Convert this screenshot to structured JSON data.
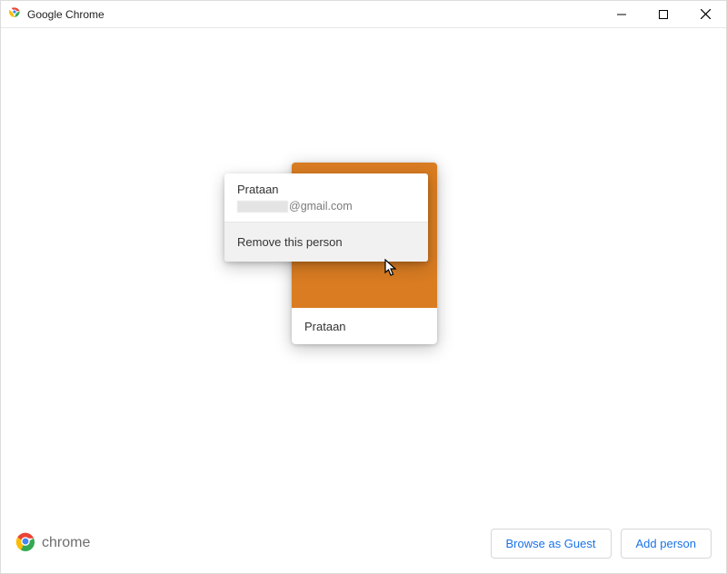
{
  "titlebar": {
    "title": "Google Chrome"
  },
  "profile": {
    "name": "Prataan",
    "email_suffix": "@gmail.com",
    "card_color": "#d97c22"
  },
  "context_menu": {
    "name": "Prataan",
    "remove_label": "Remove this person"
  },
  "footer": {
    "brand": "chrome",
    "browse_guest": "Browse as Guest",
    "add_person": "Add person"
  }
}
